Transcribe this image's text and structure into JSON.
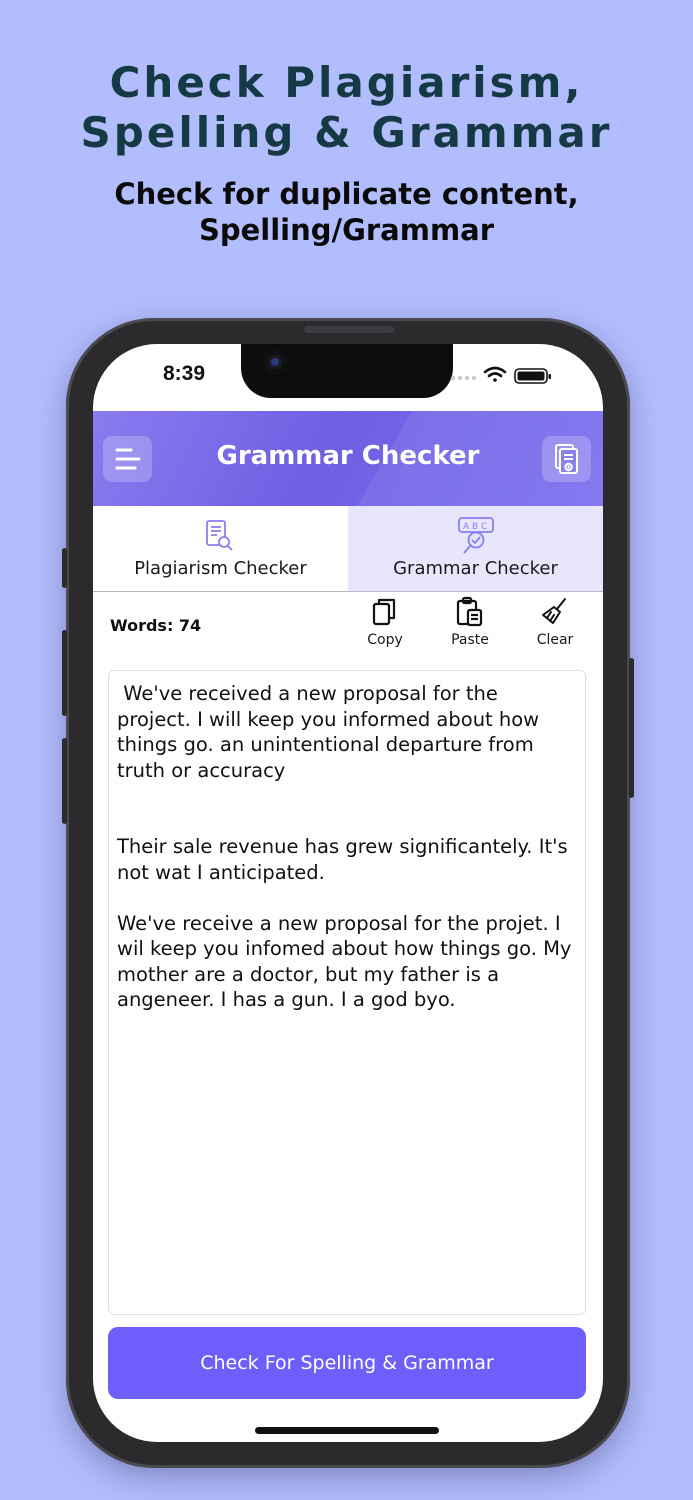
{
  "promo": {
    "title_line1": "Check Plagiarism,",
    "title_line2": "Spelling & Grammar",
    "subtitle_line1": "Check for duplicate content,",
    "subtitle_line2": "Spelling/Grammar"
  },
  "status_bar": {
    "time": "8:39",
    "icons": [
      "signal-icon",
      "wifi-icon",
      "battery-icon"
    ]
  },
  "header": {
    "title": "Grammar Checker",
    "left_icon": "menu-icon",
    "right_icon": "upload-document-icon",
    "accent": "#6f5fe3"
  },
  "tabs": [
    {
      "label": "Plagiarism Checker",
      "icon": "document-search-icon",
      "active": false
    },
    {
      "label": "Grammar Checker",
      "icon": "spell-check-icon",
      "active": true
    }
  ],
  "toolbar": {
    "word_count": "Words: 74",
    "copy_label": "Copy",
    "paste_label": "Paste",
    "clear_label": "Clear"
  },
  "editor": {
    "text": " We've received a new proposal for the project. I will keep you informed about how things go. an unintentional departure from truth or accuracy\n\n\nTheir sale revenue has grew significantely. It's not wat I anticipated.\n\nWe've receive a new proposal for the projet. I wil keep you infomed about how things go. My mother are a doctor, but my father is a angeneer. I has a gun. I a god byo."
  },
  "check_button": {
    "label": "Check For Spelling & Grammar",
    "color": "#6e5ffa"
  }
}
